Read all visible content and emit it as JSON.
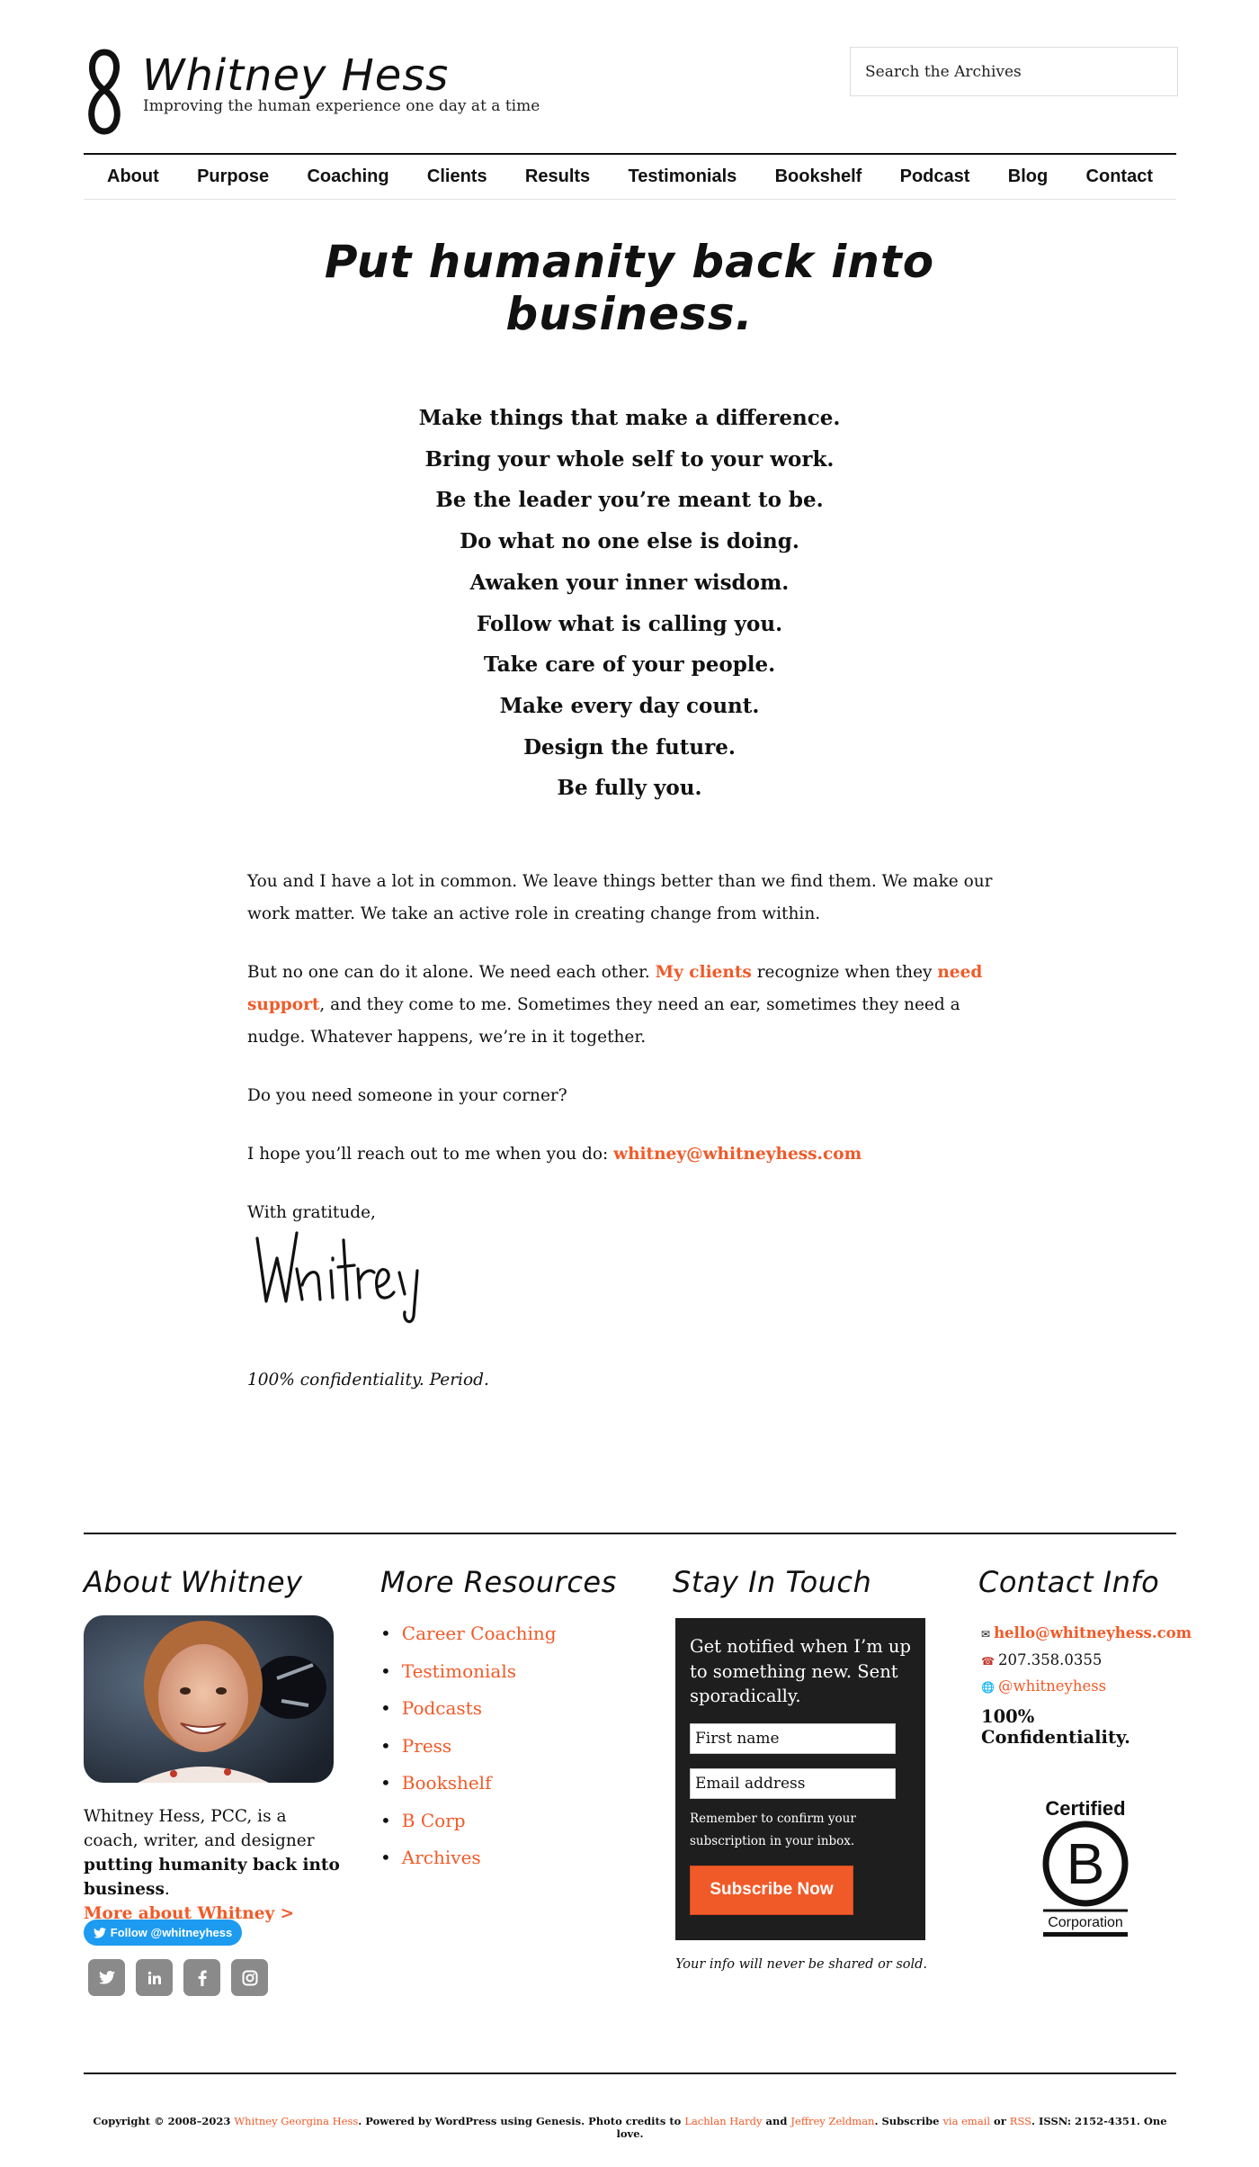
{
  "site": {
    "title": "Whitney Hess",
    "tagline": "Improving the human experience one day at a time",
    "search_placeholder": "Search the Archives"
  },
  "nav": {
    "items": [
      "About",
      "Purpose",
      "Coaching",
      "Clients",
      "Results",
      "Testimonials",
      "Bookshelf",
      "Podcast",
      "Blog",
      "Contact"
    ]
  },
  "main": {
    "heading": "Put humanity back into business.",
    "mantras": [
      "Make things that make a difference.",
      "Bring your whole self to your work.",
      "Be the leader you’re meant to be.",
      "Do what no one else is doing.",
      "Awaken your inner wisdom.",
      "Follow what is calling you.",
      "Take care of your people.",
      "Make every day count.",
      "Design the future.",
      "Be fully you."
    ],
    "p1": "You and I have a lot in common. We leave things better than we find them. We make our work matter. We take an active role in creating change from within.",
    "p2_a": "But no one can do it alone. We need each other. ",
    "p2_link1": "My clients",
    "p2_b": " recognize when they ",
    "p2_link2": "need support",
    "p2_c": ", and they come to me. Sometimes they need an ear, sometimes they need a nudge. Whatever happens, we’re in it together.",
    "p3": "Do you need someone in your corner?",
    "p4_a": "I hope you’ll reach out to me when you do: ",
    "p4_email": "whitney@whitneyhess.com",
    "p5": "With gratitude,",
    "signature": "Whitney",
    "closing": "100% confidentiality. Period."
  },
  "footer": {
    "about": {
      "title": "About Whitney",
      "bio_a": "Whitney Hess, PCC, is a coach, writer, and designer ",
      "bio_b": "putting humanity back into business",
      "bio_c": ".",
      "more_link": "More about Whitney >",
      "twitter_follow": "Follow @whitneyhess"
    },
    "resources": {
      "title": "More Resources",
      "items": [
        "Career Coaching",
        "Testimonials",
        "Podcasts",
        "Press",
        "Bookshelf",
        "B Corp",
        "Archives"
      ]
    },
    "stay": {
      "title": "Stay In Touch",
      "text": "Get notified when I’m up to something new. Sent sporadically.",
      "first_name_placeholder": "First name",
      "email_placeholder": "Email address",
      "note": "Remember to confirm your subscription in your inbox.",
      "button": "Subscribe Now",
      "privacy": "Your info will never be shared or sold."
    },
    "contact": {
      "title": "Contact Info",
      "email": "hello@whitneyhess.com",
      "phone": "207.358.0355",
      "handle": "@whitneyhess",
      "confidential": "100% Confidentiality.",
      "bcorp_top": "Certified",
      "bcorp_letter": "B",
      "bcorp_bottom": "Corporation"
    }
  },
  "copyright": {
    "a": "Copyright © 2008–2023 ",
    "name": "Whitney Georgina Hess",
    "b": ". Powered by WordPress using Genesis. Photo credits to ",
    "credit1": "Lachlan Hardy",
    "c": " and ",
    "credit2": "Jeffrey Zeldman",
    "d": ". Subscribe ",
    "via_email": "via email",
    "e": " or ",
    "rss": "RSS",
    "f": ". ISSN: 2152-4351. One love."
  },
  "colors": {
    "accent": "#f05a28",
    "twitter": "#1d9bf0",
    "dark_box": "#1e1e1e"
  }
}
